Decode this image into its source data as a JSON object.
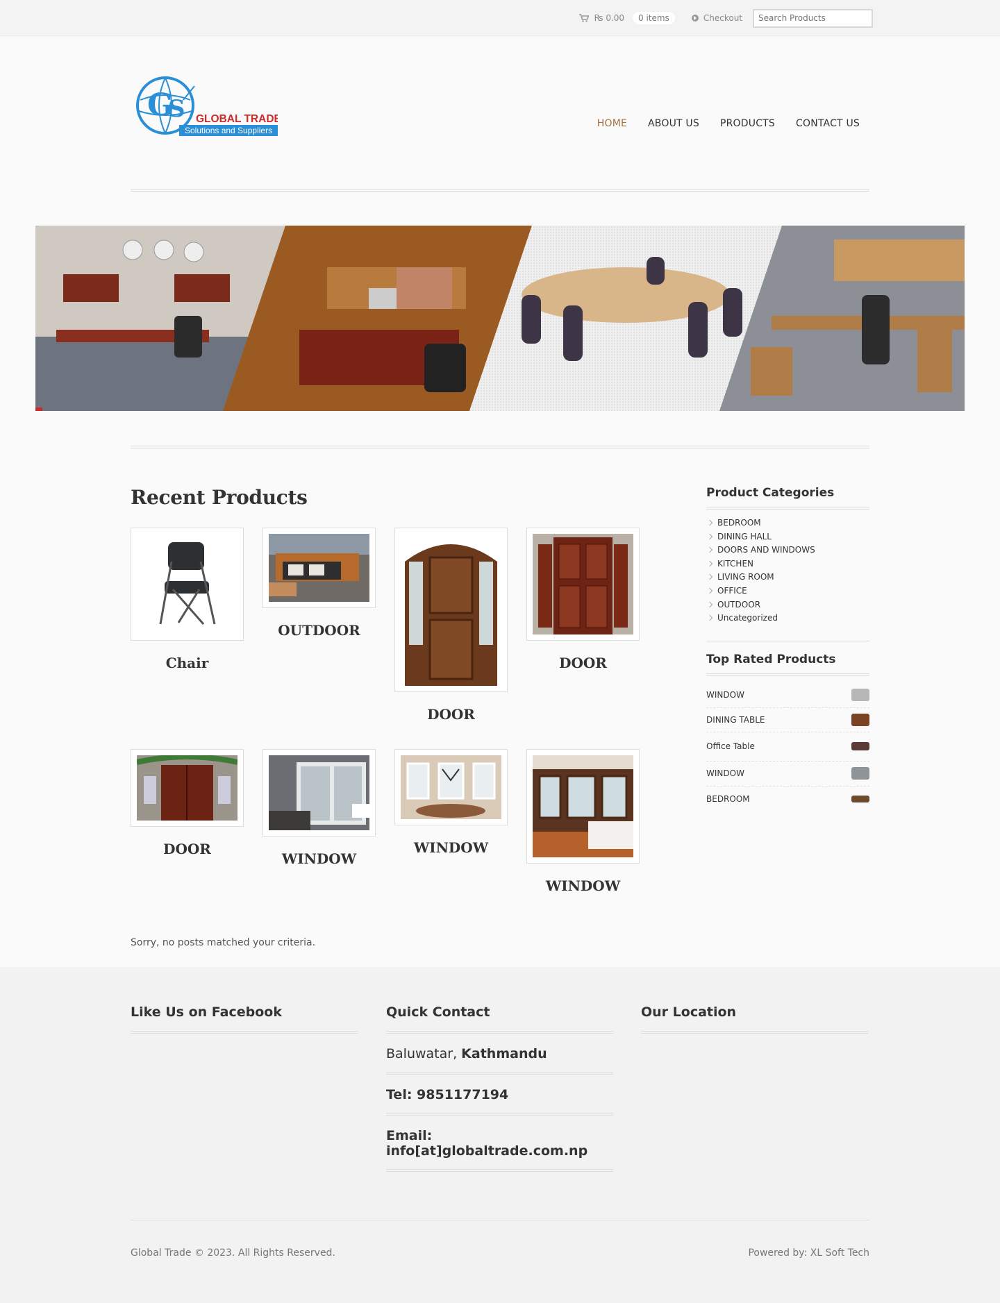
{
  "topbar": {
    "cart_total": "₨ 0.00",
    "items": "0 items",
    "checkout": "Checkout",
    "search_placeholder": "Search Products"
  },
  "logo": {
    "name": "GLOBAL TRADE",
    "tagline": "Solutions and Suppliers"
  },
  "nav": [
    {
      "label": "HOME",
      "active": true
    },
    {
      "label": "ABOUT US"
    },
    {
      "label": "PRODUCTS"
    },
    {
      "label": "CONTACT US"
    }
  ],
  "recent": {
    "title": "Recent Products",
    "products": [
      "Chair",
      "OUTDOOR",
      "DOOR",
      "DOOR",
      "DOOR",
      "WINDOW",
      "WINDOW",
      "WINDOW"
    ]
  },
  "notice": "Sorry, no posts matched your criteria.",
  "sidebar": {
    "categories_title": "Product Categories",
    "categories": [
      "BEDROOM",
      "DINING HALL",
      "DOORS AND WINDOWS",
      "KITCHEN",
      "LIVING ROOM",
      "OFFICE",
      "OUTDOOR",
      "Uncategorized"
    ],
    "rated_title": "Top Rated Products",
    "rated": [
      "WINDOW",
      "DINING TABLE",
      "Office Table",
      "WINDOW",
      "BEDROOM"
    ]
  },
  "footer": {
    "facebook_title": "Like Us on Facebook",
    "contact_title": "Quick Contact",
    "address_prefix": "Baluwatar, ",
    "address_city": "Kathmandu",
    "tel": "Tel: 9851177194",
    "email": "Email: info[at]globaltrade.com.np",
    "location_title": "Our Location",
    "copyright": "Global Trade © 2023. All Rights Reserved.",
    "powered": "Powered by: XL Soft Tech"
  },
  "colors": {
    "accent": "#a4703d",
    "logo_blue": "#2a8fd6",
    "logo_red": "#d12a2a"
  }
}
